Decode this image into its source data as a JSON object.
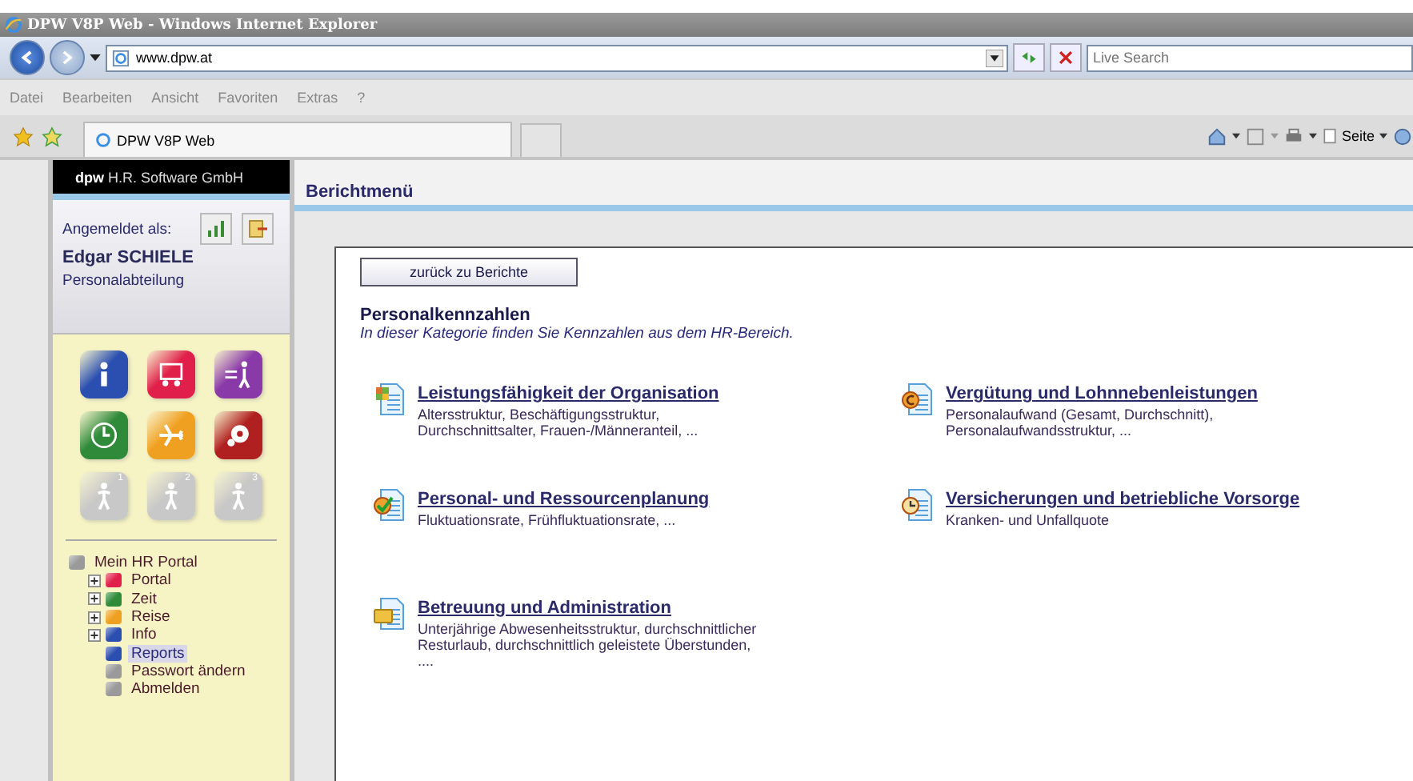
{
  "window": {
    "title": "DPW V8P Web - Windows Internet Explorer"
  },
  "address": {
    "url": "www.dpw.at",
    "search_placeholder": "Live Search"
  },
  "menu": [
    "Datei",
    "Bearbeiten",
    "Ansicht",
    "Favoriten",
    "Extras",
    "?"
  ],
  "tab": {
    "label": "DPW V8P Web"
  },
  "command_bar": {
    "page_label": "Seite"
  },
  "sidebar": {
    "brand": "dpw",
    "company": "H.R. Software GmbH",
    "logged_in_label": "Angemeldet als:",
    "user": "Edgar SCHIELE",
    "department": "Personalabteilung",
    "tiles": [
      {
        "kind": "info",
        "color": "#2a4fb0"
      },
      {
        "kind": "board",
        "color": "#e0204a"
      },
      {
        "kind": "walker",
        "color": "#8a3aa8"
      },
      {
        "kind": "clock",
        "color": "#2f8a3a"
      },
      {
        "kind": "plane",
        "color": "#f0a020"
      },
      {
        "kind": "disc",
        "color": "#b02020"
      },
      {
        "kind": "person",
        "color": "#c8c8c8",
        "badge": "1"
      },
      {
        "kind": "person",
        "color": "#c8c8c8",
        "badge": "2"
      },
      {
        "kind": "person",
        "color": "#c8c8c8",
        "badge": "3"
      }
    ],
    "tree": [
      {
        "label": "Mein HR Portal",
        "color": "#9a9a9a",
        "selected": false,
        "children": [
          {
            "label": "Portal",
            "color": "#e0204a",
            "selected": false,
            "expanded": false
          },
          {
            "label": "Zeit",
            "color": "#2f8a3a",
            "selected": false,
            "expanded": false
          },
          {
            "label": "Reise",
            "color": "#f0a020",
            "selected": false,
            "expanded": false
          },
          {
            "label": "Info",
            "color": "#2a4fb0",
            "selected": false,
            "expanded": false
          },
          {
            "label": "Reports",
            "color": "#2a4fb0",
            "selected": true
          },
          {
            "label": "Passwort ändern",
            "color": "#9a9a9a",
            "selected": false
          },
          {
            "label": "Abmelden",
            "color": "#9a9a9a",
            "selected": false
          }
        ]
      }
    ]
  },
  "main": {
    "title": "Berichtmenü",
    "back_button": "zurück zu Berichte",
    "heading": "Personalkennzahlen",
    "intro": "In dieser Kategorie finden Sie Kennzahlen aus dem HR-Bereich.",
    "reports": [
      {
        "kind": "grid",
        "title": "Leistungsfähigkeit der Organisation",
        "lines": [
          "Altersstruktur, Beschäftigungsstruktur,",
          "Durchschnittsalter, Frauen-/Männeranteil, ..."
        ]
      },
      {
        "kind": "coin",
        "title": "Vergütung und Lohnnebenleistungen",
        "lines": [
          "Personalaufwand (Gesamt, Durchschnitt),",
          "Personalaufwandsstruktur, ..."
        ]
      },
      {
        "kind": "check",
        "title": "Personal- und Ressourcenplanung",
        "lines": [
          "Fluktuationsrate, Frühfluktuationsrate, ..."
        ]
      },
      {
        "kind": "clock",
        "title": "Versicherungen und betriebliche Vorsorge",
        "lines": [
          "Kranken- und Unfallquote"
        ]
      },
      {
        "kind": "folder",
        "title": "Betreuung und Administration",
        "lines": [
          "Unterjährige Abwesenheitsstruktur, durchschnittlicher",
          "Resturlaub, durchschnittlich geleistete Überstunden,",
          "...."
        ]
      }
    ]
  }
}
